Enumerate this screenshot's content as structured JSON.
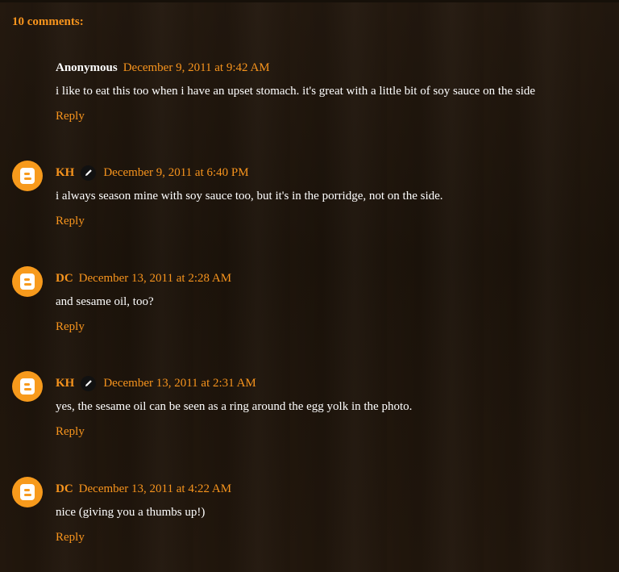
{
  "comments_count": "10 comments:",
  "comments": [
    {
      "author": "Anonymous",
      "author_is_link": false,
      "has_avatar": false,
      "has_pencil": false,
      "date": "December 9, 2011 at 9:42 AM",
      "text": "i like to eat this too when i have an upset stomach. it's great with a little bit of soy sauce on the side",
      "reply": "Reply"
    },
    {
      "author": "KH",
      "author_is_link": true,
      "has_avatar": true,
      "has_pencil": true,
      "date": "December 9, 2011 at 6:40 PM",
      "text": "i always season mine with soy sauce too, but it's in the porridge, not on the side.",
      "reply": "Reply"
    },
    {
      "author": "DC",
      "author_is_link": true,
      "has_avatar": true,
      "has_pencil": false,
      "date": "December 13, 2011 at 2:28 AM",
      "text": "and sesame oil, too?",
      "reply": "Reply"
    },
    {
      "author": "KH",
      "author_is_link": true,
      "has_avatar": true,
      "has_pencil": true,
      "date": "December 13, 2011 at 2:31 AM",
      "text": "yes, the sesame oil can be seen as a ring around the egg yolk in the photo.",
      "reply": "Reply"
    },
    {
      "author": "DC",
      "author_is_link": true,
      "has_avatar": true,
      "has_pencil": false,
      "date": "December 13, 2011 at 4:22 AM",
      "text": "nice (giving you a thumbs up!)",
      "reply": "Reply"
    }
  ],
  "colors": {
    "link": "#f7941d",
    "text": "#ffffff",
    "background": "#22170d",
    "avatar": "#f79a1c"
  },
  "icons": {
    "avatar": "blogger-icon",
    "pencil": "pencil-icon"
  }
}
